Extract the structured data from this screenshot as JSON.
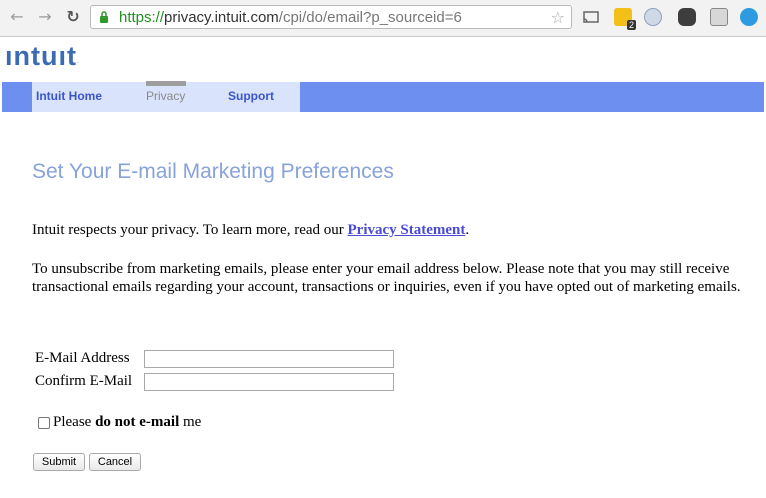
{
  "browser": {
    "url_scheme": "https://",
    "url_host": "privacy.intuit.com",
    "url_path": "/cpi/do/email?p_sourceid=6",
    "extension_badge": "2"
  },
  "logo": {
    "text": "ıntuıt",
    "mark": "."
  },
  "nav": {
    "tabs": [
      "Intuit Home",
      "Privacy",
      "Support"
    ]
  },
  "page": {
    "heading": "Set Your E-mail Marketing Preferences",
    "intro_text": "Intuit respects your privacy. To learn more, read our ",
    "privacy_link": "Privacy Statement",
    "intro_end": ".",
    "unsubscribe_text": "To unsubscribe from marketing emails, please enter your email address below. Please note that you may still receive transactional emails regarding your account, transactions or inquiries, even if you have opted out of marketing emails."
  },
  "form": {
    "email_label": "E-Mail Address",
    "email_value": "",
    "confirm_label": "Confirm E-Mail",
    "confirm_value": "",
    "checkbox_prefix": "Please ",
    "checkbox_bold": "do not e-mail",
    "checkbox_suffix": " me",
    "submit_label": "Submit",
    "cancel_label": "Cancel"
  }
}
